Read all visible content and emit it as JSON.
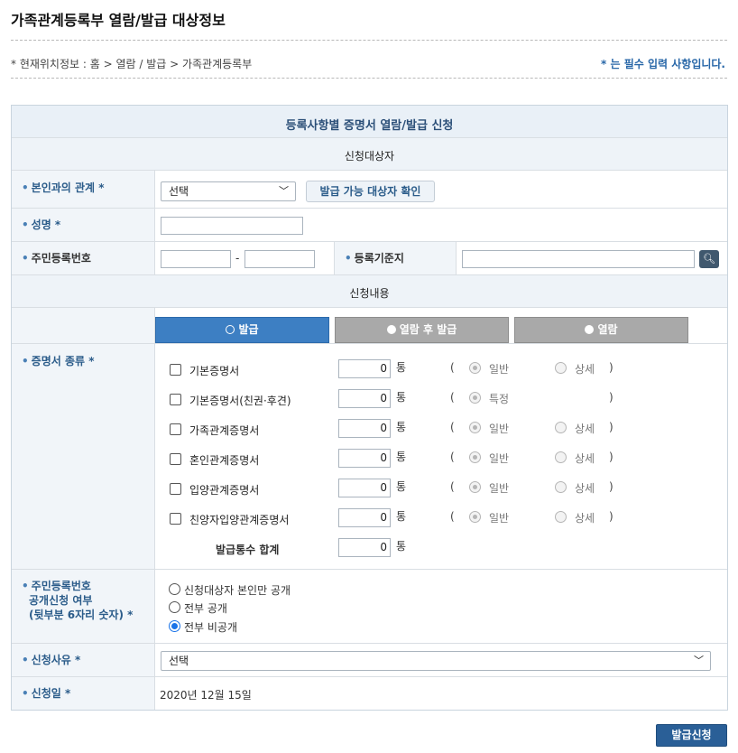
{
  "page": {
    "title": "가족관계등록부 열람/발급 대상정보",
    "breadcrumb": "* 현재위치정보 : 홈 > 열람 / 발급 > 가족관계등록부",
    "required_note": "* 는 필수 입력 사항입니다."
  },
  "form": {
    "header": "등록사항별 증명서 열람/발급 신청",
    "section_target": "신청대상자",
    "relation": {
      "label": "본인과의 관계 *",
      "selected": "선택",
      "check_button": "발급 가능 대상자 확인"
    },
    "name": {
      "label": "성명 *",
      "value": ""
    },
    "rrn": {
      "label": "주민등록번호",
      "separator": "-",
      "front": "",
      "back": ""
    },
    "reg_base": {
      "label": "등록기준지",
      "value": ""
    },
    "section_content": "신청내용",
    "tabs": [
      {
        "label": "발급",
        "active": true
      },
      {
        "label": "열람 후 발급",
        "active": false
      },
      {
        "label": "열람",
        "active": false
      }
    ],
    "cert_type": {
      "label": "증명서 종류 *",
      "unit": "통",
      "paren_open": "(",
      "paren_close": ")",
      "items": [
        {
          "name": "기본증명서",
          "qty": "0",
          "opt1": "일반",
          "opt2": "상세"
        },
        {
          "name": "기본증명서(친권·후견)",
          "qty": "0",
          "opt1": "특정",
          "opt2": ""
        },
        {
          "name": "가족관계증명서",
          "qty": "0",
          "opt1": "일반",
          "opt2": "상세"
        },
        {
          "name": "혼인관계증명서",
          "qty": "0",
          "opt1": "일반",
          "opt2": "상세"
        },
        {
          "name": "입양관계증명서",
          "qty": "0",
          "opt1": "일반",
          "opt2": "상세"
        },
        {
          "name": "친양자입양관계증명서",
          "qty": "0",
          "opt1": "일반",
          "opt2": "상세"
        }
      ],
      "total_label": "발급통수 합계",
      "total_qty": "0"
    },
    "rrn_disclosure": {
      "label_line1": "주민등록번호",
      "label_line2": "공개신청 여부",
      "label_line3": "(뒷부분 6자리 숫자) *",
      "options": [
        "신청대상자 본인만 공개",
        "전부 공개",
        "전부 비공개"
      ],
      "selected_index": 2
    },
    "reason": {
      "label": "신청사유 *",
      "selected": "선택"
    },
    "date": {
      "label": "신청일 *",
      "value": "2020년 12월 15일"
    }
  },
  "submit_label": "발급신청"
}
